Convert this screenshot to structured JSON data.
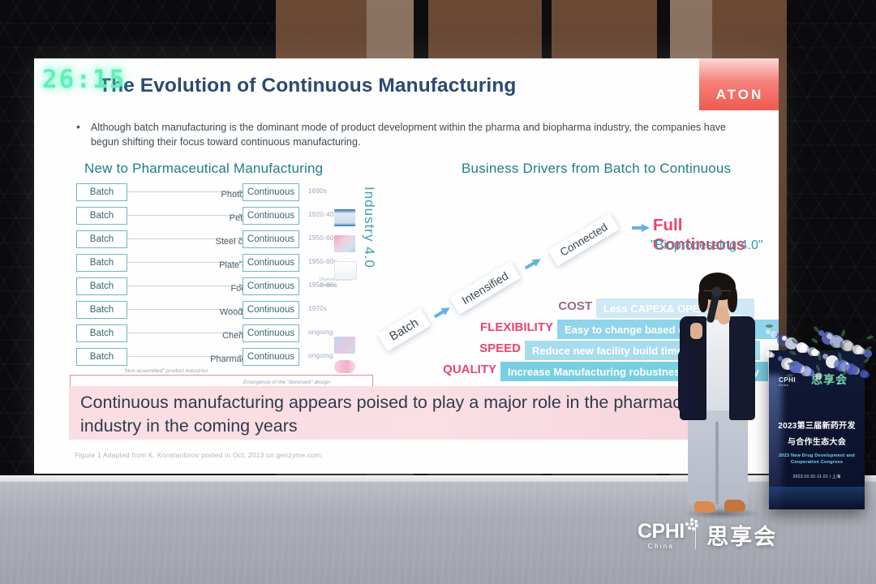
{
  "timer": {
    "value": "26:15"
  },
  "slide": {
    "title": "The Evolution of Continuous Manufacturing",
    "logo": "ATON",
    "bullet": "Although batch manufacturing is the dominant mode of product development within the pharma and biopharma industry, the companies have begun shifting their focus toward continuous manufacturing.",
    "left_heading": "New to Pharmaceutical Manufacturing",
    "right_heading": "Business Drivers from Batch to Continuous",
    "industry_label": "Industry 4.0",
    "table": {
      "batch_label": "Batch",
      "continuous_label": "Continuous",
      "rows": [
        {
          "industry": "Photo film",
          "date": "1890s",
          "note": ""
        },
        {
          "industry": "Petrol",
          "date": "1920-40s",
          "note": ""
        },
        {
          "industry": "Steel casting",
          "date": "1950-60s",
          "note": ""
        },
        {
          "industry": "Plate glass",
          "date": "1950-60s",
          "note": ""
        },
        {
          "industry": "Food",
          "date": "1950-80s",
          "note": "Diverse process designs"
        },
        {
          "industry": "Wood pulp",
          "date": "1970s",
          "note": ""
        },
        {
          "industry": "Chemical",
          "date": "ongoing",
          "note": ""
        },
        {
          "industry": "Pharmaceutical",
          "date": "ongoing",
          "note": ""
        }
      ],
      "footnote_left": "\"Non-assembled\" product industries",
      "footnote_right": "Emergence of the \"dominant\" design"
    },
    "progression": {
      "steps": [
        "Batch",
        "Intensified",
        "Connected"
      ],
      "result_title": "Full Continuous",
      "result_sub": "\"Bioprocessing 4.0\""
    },
    "drivers": [
      {
        "label": "COST",
        "text": "Less CAPEX& OPEX"
      },
      {
        "label": "FLEXIBILITY",
        "text": "Easy to change based on demand"
      },
      {
        "label": "SPEED",
        "text": "Reduce new facility build time"
      },
      {
        "label": "QUALITY",
        "text": "Increase Manufacturing robustness and capability"
      }
    ],
    "banner": "Continuous manufacturing appears poised to play a major role in the pharmaceutical industry in the coming years",
    "citation": "Figure 1 Adapted from K. Konstantinov posted  in Oct, 2013 on genzyme.com;"
  },
  "podium": {
    "logo": "CPHI",
    "logo_sub": "China",
    "logo_cn": "思享会",
    "title_line1": "2023第三届新药开发",
    "title_line2": "与合作生态大会",
    "subtitle_en": "2023 New Drug Development and Cooperation Congress",
    "date_city": "2023.10.31-11.01 | 上海"
  },
  "branding": {
    "cphi": "CPHI",
    "cphi_sub": "China",
    "session": "思享会"
  },
  "colors": {
    "title_blue": "#2b4a6f",
    "teal": "#1f7e86",
    "pink": "#e8456d",
    "driver_pink": "#e8456d",
    "logo_red": "#ef5a50",
    "timer_green": "#5ff0b6"
  }
}
